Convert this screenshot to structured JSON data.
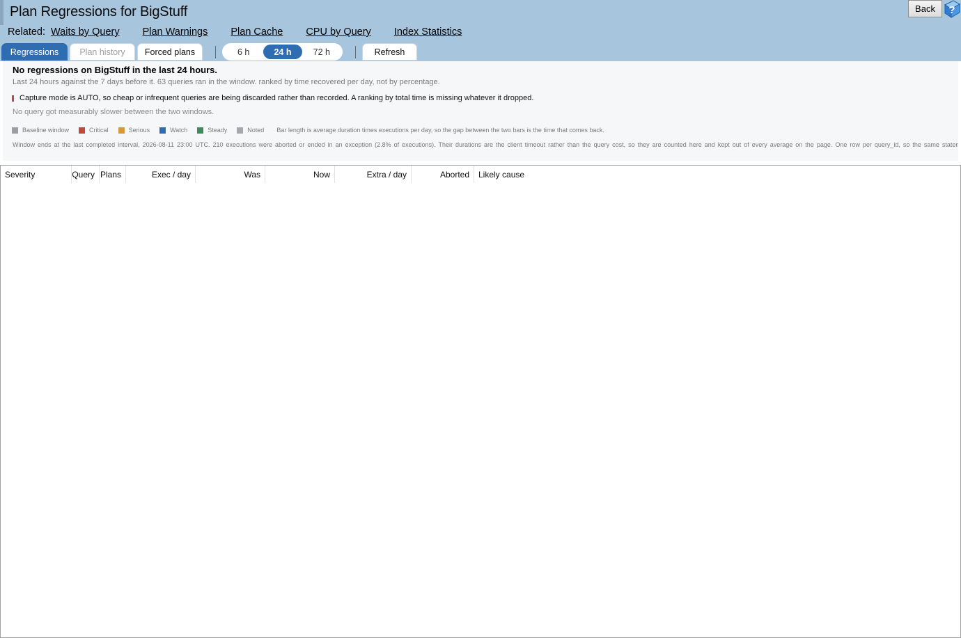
{
  "header": {
    "title": "Plan Regressions for BigStuff",
    "back_label": "Back",
    "help_icon": "help-book-icon"
  },
  "related": {
    "label": "Related:",
    "links": [
      "Waits by Query",
      "Plan Warnings",
      "Plan Cache",
      "CPU by Query",
      "Index Statistics"
    ]
  },
  "tabs": {
    "regressions": "Regressions",
    "plan_history": "Plan history",
    "forced_plans": "Forced plans",
    "active": "Regressions"
  },
  "range": {
    "options": [
      "6 h",
      "24 h",
      "72 h"
    ],
    "selected": "24 h"
  },
  "refresh_label": "Refresh",
  "info": {
    "title": "No regressions on BigStuff in the last 24 hours.",
    "subtitle": "Last 24 hours against the 7 days before it. 63 queries ran in the window. ranked by time recovered per day, not by percentage.",
    "warning": "Capture mode is AUTO, so cheap or infrequent queries are being discarded rather than recorded. A ranking by total time is missing whatever it dropped.",
    "no_slower": "No query got measurably slower between the two windows.",
    "legend": [
      {
        "label": "Baseline window",
        "color": "#9b9ea3"
      },
      {
        "label": "Critical",
        "color": "#c0493b"
      },
      {
        "label": "Serious",
        "color": "#d49b3a"
      },
      {
        "label": "Watch",
        "color": "#2f6db3"
      },
      {
        "label": "Steady",
        "color": "#3f8a5a"
      },
      {
        "label": "Noted",
        "color": "#a6a8ad"
      }
    ],
    "bar_note": "Bar length is average duration times executions per day, so the gap between the two bars is the time that comes back.",
    "footnote": "Window ends at the last completed interval, 2026-08-11 23:00 UTC.   210 executions were aborted or ended in an exception (2.8% of executions). Their durations are the client timeout rather than the query cost, so they are counted here and kept out of every average on the page.   One row per query_id, so the same statem"
  },
  "table": {
    "columns": [
      "Severity",
      "Query",
      "Plans",
      "Exec / day",
      "Was",
      "Now",
      "Extra / day",
      "Aborted",
      "Likely cause"
    ],
    "rows": []
  }
}
